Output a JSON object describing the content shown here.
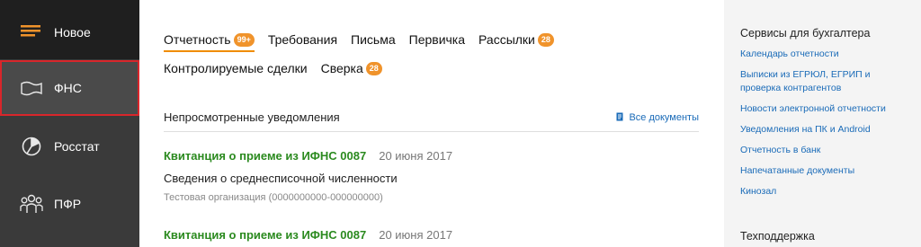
{
  "sidebar": {
    "items": [
      {
        "label": "Новое",
        "icon": "lines-icon"
      },
      {
        "label": "ФНС",
        "icon": "flag-icon"
      },
      {
        "label": "Росстат",
        "icon": "pie-chart-icon"
      },
      {
        "label": "ПФР",
        "icon": "people-icon"
      }
    ],
    "selected_border_color": "#d9262b"
  },
  "tabs": {
    "otchetnost": {
      "label": "Отчетность",
      "badge": "99+"
    },
    "trebovaniya": {
      "label": "Требования"
    },
    "pisma": {
      "label": "Письма"
    },
    "pervichka": {
      "label": "Первичка"
    },
    "rassylki": {
      "label": "Рассылки",
      "badge": "28"
    },
    "sdelki": {
      "label": "Контролируемые сделки"
    },
    "sverka": {
      "label": "Сверка",
      "badge": "28"
    }
  },
  "notices": {
    "title": "Непросмотренные уведомления",
    "all_docs_label": "Все документы",
    "items": [
      {
        "title": "Квитанция о приеме из ИФНС 0087",
        "date": "20 июня 2017",
        "subject": "Сведения о среднесписочной численности",
        "org": "Тестовая организация (0000000000-000000000)"
      },
      {
        "title": "Квитанция о приеме из ИФНС 0087",
        "date": "20 июня 2017"
      }
    ]
  },
  "right_panel": {
    "services_title": "Сервисы для бухгалтера",
    "links": [
      "Календарь отчетности",
      "Выписки из ЕГРЮЛ, ЕГРИП и проверка контрагентов",
      "Новости электронной отчетности",
      "Уведомления на ПК и Android",
      "Отчетность в банк",
      "Напечатанные документы",
      "Кинозал"
    ],
    "support_title": "Техподдержка"
  },
  "colors": {
    "accent": "#f0932b",
    "link": "#1a6bb8",
    "notice_title": "#2b8a1f"
  }
}
